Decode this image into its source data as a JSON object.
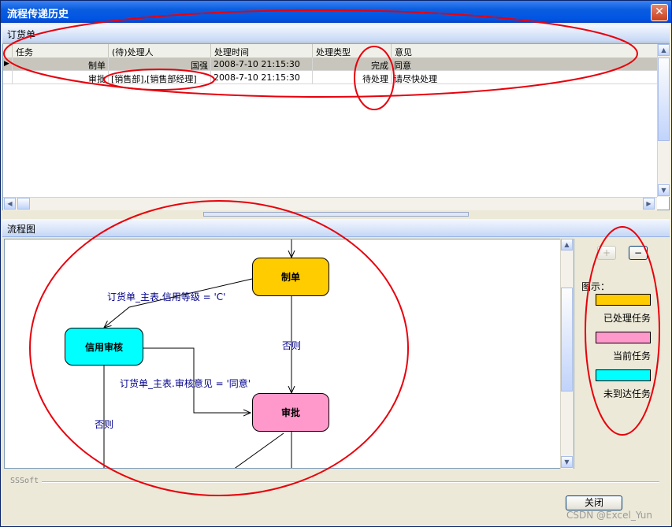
{
  "window": {
    "title": "流程传递历史",
    "close_symbol": "✕"
  },
  "grid_panel": {
    "header": "订货单",
    "columns": [
      "任务",
      "(待)处理人",
      "处理时间",
      "处理类型",
      "意见"
    ],
    "rows": [
      {
        "indicator": "▶",
        "task": "制单",
        "handler": "国强",
        "time": "2008-7-10 21:15:30",
        "type": "完成",
        "comment": "同意"
      },
      {
        "indicator": "",
        "task": "审批",
        "handler": "[销售部],[销售部经理]",
        "time": "2008-7-10 21:15:30",
        "type": "待处理",
        "comment": "请尽快处理"
      }
    ]
  },
  "flow_panel": {
    "header": "流程图",
    "nodes": {
      "make": "制单",
      "credit": "信用审核",
      "approve": "审批"
    },
    "edge_labels": {
      "credit_cond": "订货单_主表.信用等级 = 'C'",
      "otherwise_1": "否则",
      "review_cond": "订货单_主表.审核意见 = '同意'",
      "otherwise_2": "否则"
    }
  },
  "legend": {
    "zoom_in": "+",
    "zoom_out": "−",
    "title": "图示：",
    "items": [
      {
        "label": "已处理任务",
        "color": "#ffcc00"
      },
      {
        "label": "当前任务",
        "color": "#ff99cc"
      },
      {
        "label": "未到达任务",
        "color": "#00ffff"
      }
    ]
  },
  "footer": {
    "brand": "SSSoft",
    "close_button": "关闭"
  },
  "watermark": "CSDN @Excel_Yun",
  "colors": {
    "annotation": "#e8000b",
    "edge_text": "#00008b",
    "title_bar": "#0054e3"
  }
}
